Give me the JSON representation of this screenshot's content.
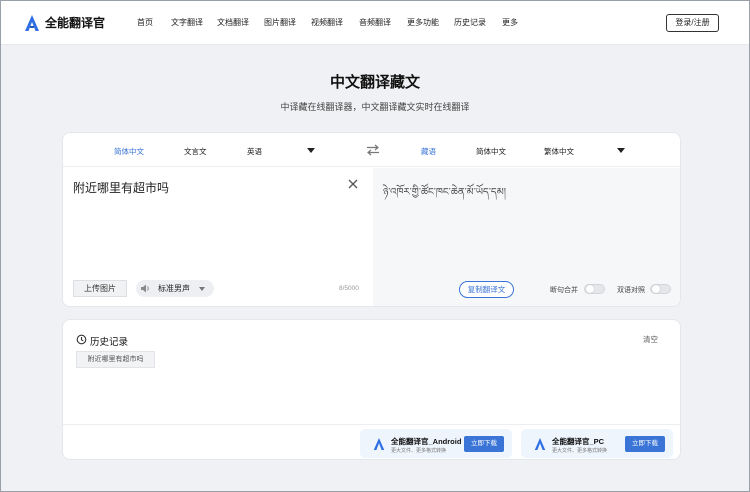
{
  "brand": {
    "name": "全能翻译官",
    "accent": "#3a74d6"
  },
  "nav": {
    "items": [
      "首页",
      "文字翻译",
      "文档翻译",
      "图片翻译",
      "视频翻译",
      "音频翻译",
      "更多功能",
      "历史记录",
      "更多"
    ],
    "login_label": "登录/注册"
  },
  "hero": {
    "title": "中文翻译藏文",
    "subtitle": "中译藏在线翻译器，中文翻译藏文实时在线翻译"
  },
  "translator": {
    "source_langs": [
      "简体中文",
      "文言文",
      "英语"
    ],
    "target_langs": [
      "藏语",
      "简体中文",
      "繁体中文"
    ],
    "source_text": "附近哪里有超市吗",
    "target_text": "ཉེ་འཁོར་གྱི་ཚོང་ཁང་ཆེན་མོ་ཡོད་དམ།",
    "upload_label": "上传图片",
    "voice_label": "标准男声",
    "counter": "8/5000",
    "copy_label": "复制翻译文",
    "toggle_merge_label": "断句合并",
    "toggle_bilingual_label": "双语对照"
  },
  "history": {
    "title": "历史记录",
    "clear_label": "清空",
    "items": [
      "附近哪里有超市吗"
    ]
  },
  "apps": [
    {
      "name": "全能翻译官_Android",
      "desc": "更大文件、更多格式转换",
      "download_label": "立即下载"
    },
    {
      "name": "全能翻译官_PC",
      "desc": "更大文件、更多格式转换",
      "download_label": "立即下载"
    }
  ]
}
